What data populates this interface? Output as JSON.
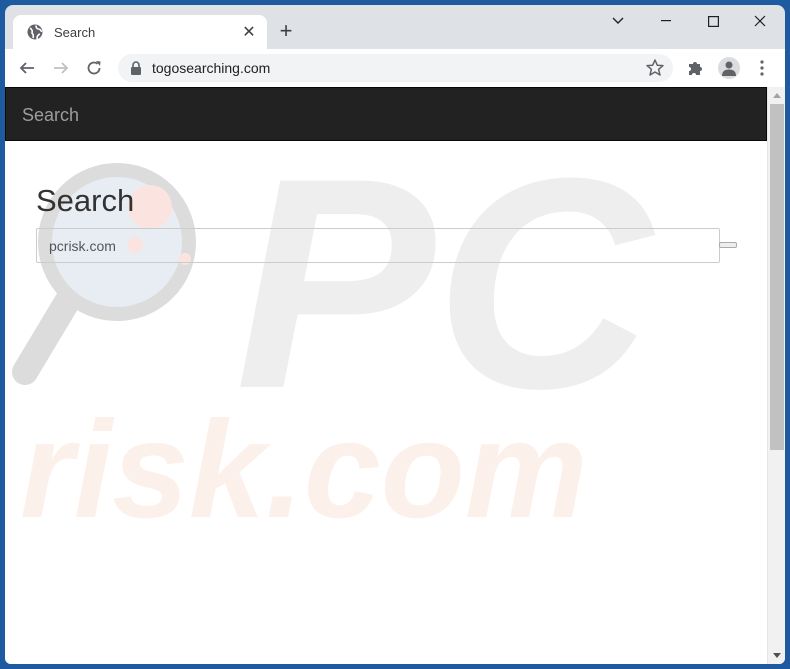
{
  "browser": {
    "tab": {
      "title": "Search",
      "icon": "globe-icon",
      "close_icon": "close-icon"
    },
    "new_tab_icon": "plus-icon",
    "window_controls": [
      "tab-search-chevron-icon",
      "minimize-icon",
      "maximize-icon",
      "close-icon"
    ],
    "nav": {
      "back": "back-arrow-icon",
      "forward": "forward-arrow-icon",
      "reload": "reload-icon"
    },
    "address_bar": {
      "url": "togosearching.com",
      "security_icon": "lock-icon",
      "bookmark_icon": "star-icon"
    },
    "toolbar_icons": [
      "extensions-puzzle-icon",
      "profile-avatar-icon",
      "menu-kebab-icon"
    ]
  },
  "page": {
    "navbar": {
      "brand": "Search"
    },
    "heading": "Search",
    "search": {
      "value": "pcrisk.com",
      "placeholder": ""
    },
    "watermark": {
      "top": "PC",
      "bottom": "risk.com"
    },
    "colors": {
      "navbar_bg": "#222222",
      "navbar_text": "#9d9d9d",
      "frame": "#1e5aa0"
    }
  },
  "scrollbar": {
    "position_fraction": 0.0,
    "visible_fraction": 0.6
  }
}
